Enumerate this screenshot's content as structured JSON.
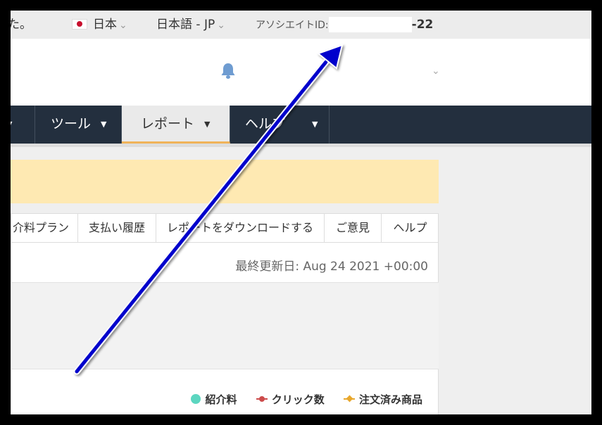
{
  "topbar": {
    "truncated_text": "た。",
    "country": {
      "label": "日本"
    },
    "language": {
      "label": "日本語 - JP"
    },
    "associate": {
      "label": "アソシエイトID:",
      "id_suffix": "-22"
    }
  },
  "header": {
    "notification_icon": "bell-icon"
  },
  "nav": {
    "items": [
      {
        "label": ""
      },
      {
        "label": "ツール"
      },
      {
        "label": "レポート"
      },
      {
        "label": "ヘルプ"
      }
    ]
  },
  "tabs": [
    "介料プラン",
    "支払い履歴",
    "レポートをダウンロードする",
    "ご意見",
    "ヘルプ"
  ],
  "report": {
    "last_updated": "最終更新日: Aug 24 2021 +00:00"
  },
  "legend": {
    "items": [
      {
        "label": "紹介料",
        "color": "#5cd6c0"
      },
      {
        "label": "クリック数",
        "color": "#cc4b4b"
      },
      {
        "label": "注文済み商品",
        "color": "#e8a72c"
      }
    ]
  },
  "annotation": {
    "arrow_color": "#0000cc"
  }
}
